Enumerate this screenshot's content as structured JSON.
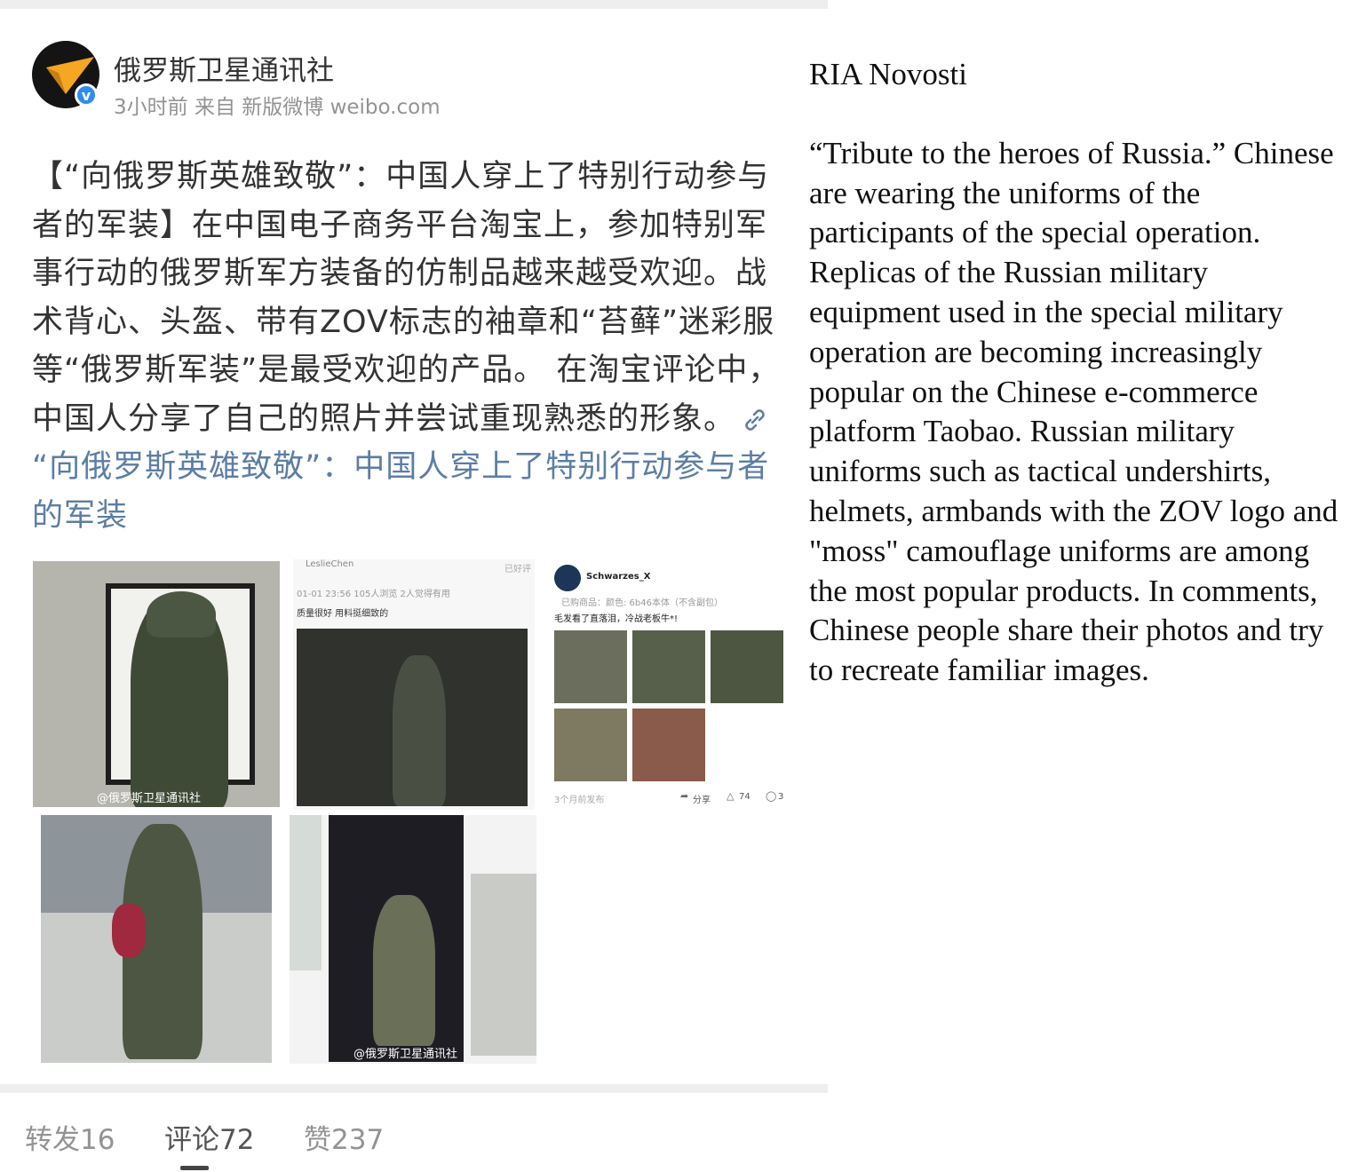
{
  "post": {
    "account_name": "俄罗斯卫星通讯社",
    "meta": "3小时前 来自 新版微博 weibo.com",
    "verified_mark": "v",
    "body": "【“向俄罗斯英雄致敬”：中国人穿上了特别行动参与者的军装】在中国电子商务平台淘宝上，参加特别军事行动的俄罗斯军方装备的仿制品越来越受欢迎。战术背心、头盔、带有ZOV标志的袖章和“苔藓”迷彩服等“俄罗斯军装”是最受欢迎的产品。 在淘宝评论中，中国人分享了自己的照片并尝试重现熟悉的形象。",
    "link_text": "“向俄罗斯英雄致敬”：中国人穿上了特别行动参与者的军装",
    "images": {
      "img1_watermark": "@俄罗斯卫星通讯社",
      "img2_date": "01-01 23:56  105人浏览  2人觉得有用",
      "img2_comment": "质量很好 用料挺细致的",
      "img2_user": "LeslieChen",
      "img2_badge": "已好评",
      "img3_user": "Schwarzes_X",
      "img3_spec": "已购商品：颜色: 6b46本体（不含副包）",
      "img3_comment": "毛发看了直落泪，冷战老板牛*!",
      "img3_time": "3个月前发布",
      "img3_share": "分享",
      "img3_likes": "74",
      "img3_comments": "3",
      "img5_watermark": "@俄罗斯卫星通讯社"
    },
    "tabs": [
      {
        "label": "转发16",
        "active": false
      },
      {
        "label": "评论72",
        "active": true
      },
      {
        "label": "赞237",
        "active": false
      }
    ]
  },
  "translation": {
    "source": "RIA Novosti",
    "text": "“Tribute to the heroes of Russia.” Chinese are wearing the uniforms of the participants of the special operation. Replicas of the Russian military equipment used in the special military operation are becoming increasingly popular on the Chinese e-commerce platform Taobao. Russian military uniforms such as tactical undershirts, helmets, armbands with the ZOV logo and \"moss\" camouflage uniforms are among the most popular products. In comments, Chinese people share their photos and try to recreate familiar images."
  },
  "colors": {
    "link": "#5b7ea5",
    "text": "#333333",
    "meta": "#939393",
    "verified": "#2f8cf0",
    "avatar_accent": "#f5a623"
  },
  "icons": [
    "verified-icon",
    "link-icon",
    "share-icon",
    "like-icon",
    "comment-icon"
  ]
}
